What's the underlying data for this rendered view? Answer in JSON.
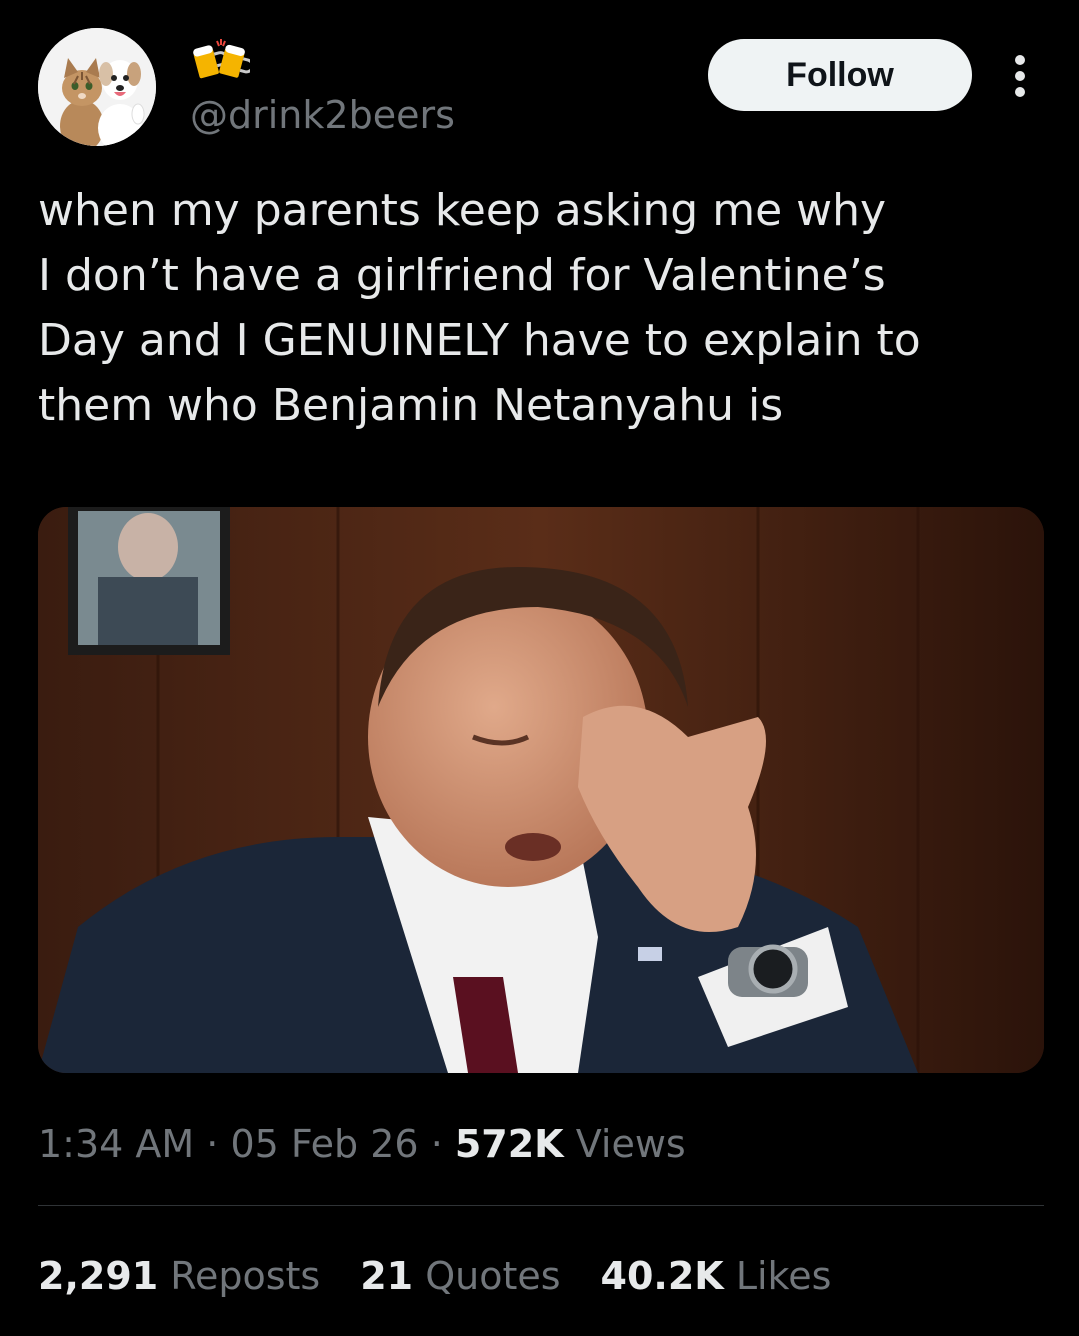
{
  "header": {
    "name_emoji": "beer-mugs-emoji",
    "handle": "@drink2beers",
    "follow_label": "Follow",
    "avatar_icon": "cat-and-dog-avatar",
    "more_icon": "more-vertical-icon"
  },
  "tweet": {
    "text": "when my parents keep asking me why\nI don’t have a girlfriend for Valentine’s\nDay and I GENUINELY have to explain to\nthem who Benjamin Netanyahu is"
  },
  "meta": {
    "time": "1:34 AM",
    "sep1": " · ",
    "date": "05 Feb 26",
    "sep2": " · ",
    "views_count": "572K",
    "views_label": " Views"
  },
  "stats": {
    "reposts_count": "2,291",
    "reposts_label": " Reposts",
    "quotes_count": "21",
    "quotes_label": " Quotes",
    "likes_count": "40.2K",
    "likes_label": " Likes"
  },
  "colors": {
    "background": "#000000",
    "text": "#e7e9ea",
    "secondary": "#71767b",
    "follow_bg": "#eff3f4",
    "follow_text": "#0f1419",
    "divider": "#2f3336"
  }
}
